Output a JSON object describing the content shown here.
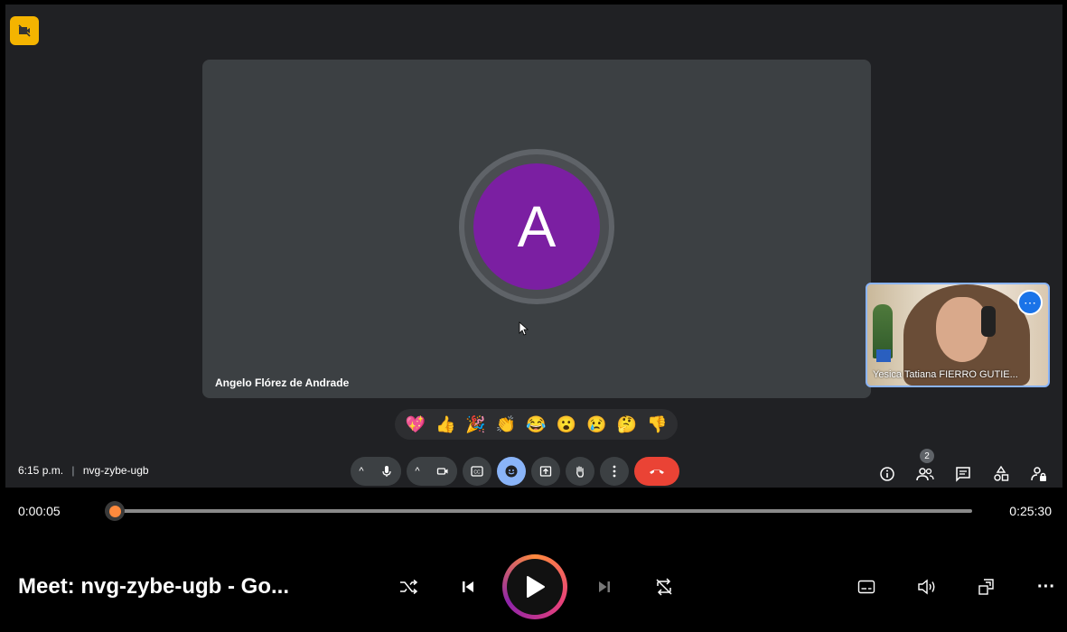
{
  "meet": {
    "main_participant": {
      "initial": "A",
      "name": "Angelo Flórez de Andrade"
    },
    "self_view": {
      "name": "Yesica Tatiana FIERRO GUTIE..."
    },
    "reactions": [
      "💖",
      "👍",
      "🎉",
      "👏",
      "😂",
      "😮",
      "😢",
      "🤔",
      "👎"
    ],
    "clock": "6:15 p.m.",
    "separator": "|",
    "meeting_code": "nvg-zybe-ugb",
    "people_count": "2",
    "more_label": "⋯",
    "colors": {
      "avatar": "#7b1fa2",
      "end_call": "#ea4335",
      "active_reaction": "#8ab4f8",
      "badge": "#f4b400"
    }
  },
  "player": {
    "current_time": "0:00:05",
    "total_time": "0:25:30",
    "progress": 0.0033,
    "title": "Meet: nvg-zybe-ugb - Go...",
    "more_label": "···",
    "accent": "#ff8a3d"
  }
}
